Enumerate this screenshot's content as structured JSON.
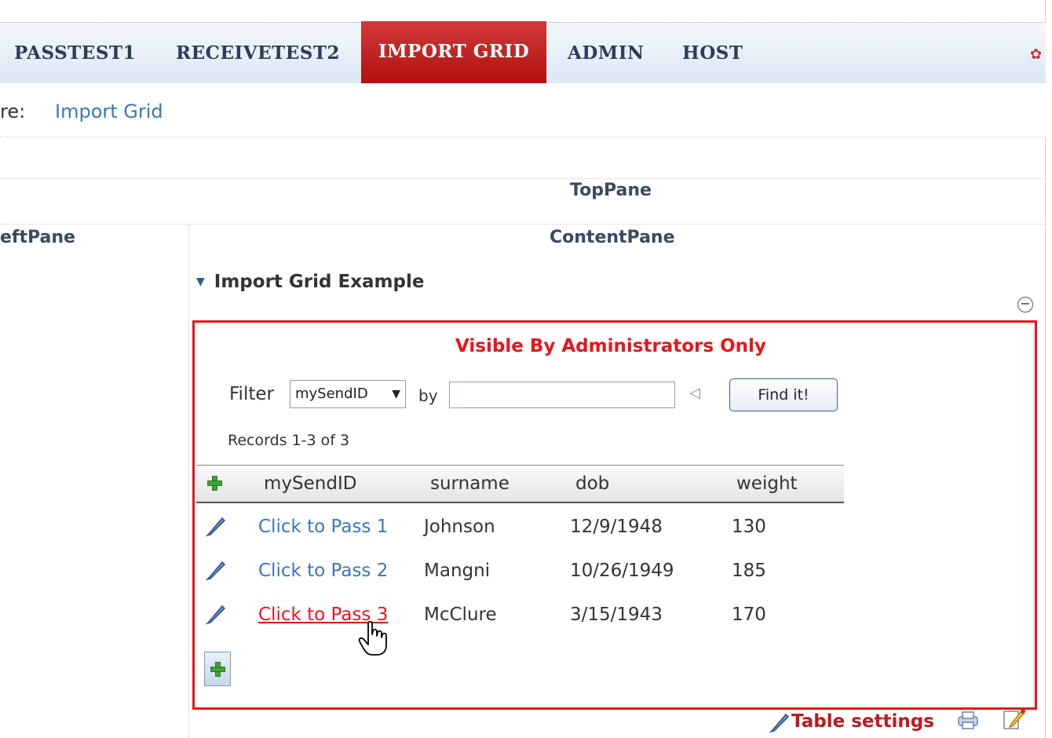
{
  "nav": {
    "items": [
      {
        "label": "PASSTEST1"
      },
      {
        "label": "RECEIVETEST2"
      },
      {
        "label": "IMPORT GRID",
        "active": true
      },
      {
        "label": "ADMIN"
      },
      {
        "label": "HOST"
      }
    ]
  },
  "breadcrumb": {
    "prefix": "re:",
    "link": "Import Grid"
  },
  "panes": {
    "top": "TopPane",
    "left": "eftPane",
    "content": "ContentPane"
  },
  "module": {
    "title": "Import Grid Example",
    "admin_notice": "Visible By Administrators Only",
    "filter": {
      "label": "Filter",
      "selected_field": "mySendID",
      "by_label": "by",
      "value": "",
      "button_label": "Find it!"
    },
    "records_text": "Records 1-3 of 3",
    "grid": {
      "columns": [
        "mySendID",
        "surname",
        "dob",
        "weight"
      ],
      "rows": [
        {
          "link": "Click to Pass 1",
          "surname": "Johnson",
          "dob": "12/9/1948",
          "weight": "130"
        },
        {
          "link": "Click to Pass 2",
          "surname": "Mangni",
          "dob": "10/26/1949",
          "weight": "185"
        },
        {
          "link": "Click to Pass 3",
          "surname": "McClure",
          "dob": "3/15/1943",
          "weight": "170"
        }
      ]
    },
    "table_settings_label": "Table settings"
  },
  "colors": {
    "accent_red": "#e8151b",
    "link_blue": "#3b77b5",
    "nav_active": "#c01818"
  }
}
